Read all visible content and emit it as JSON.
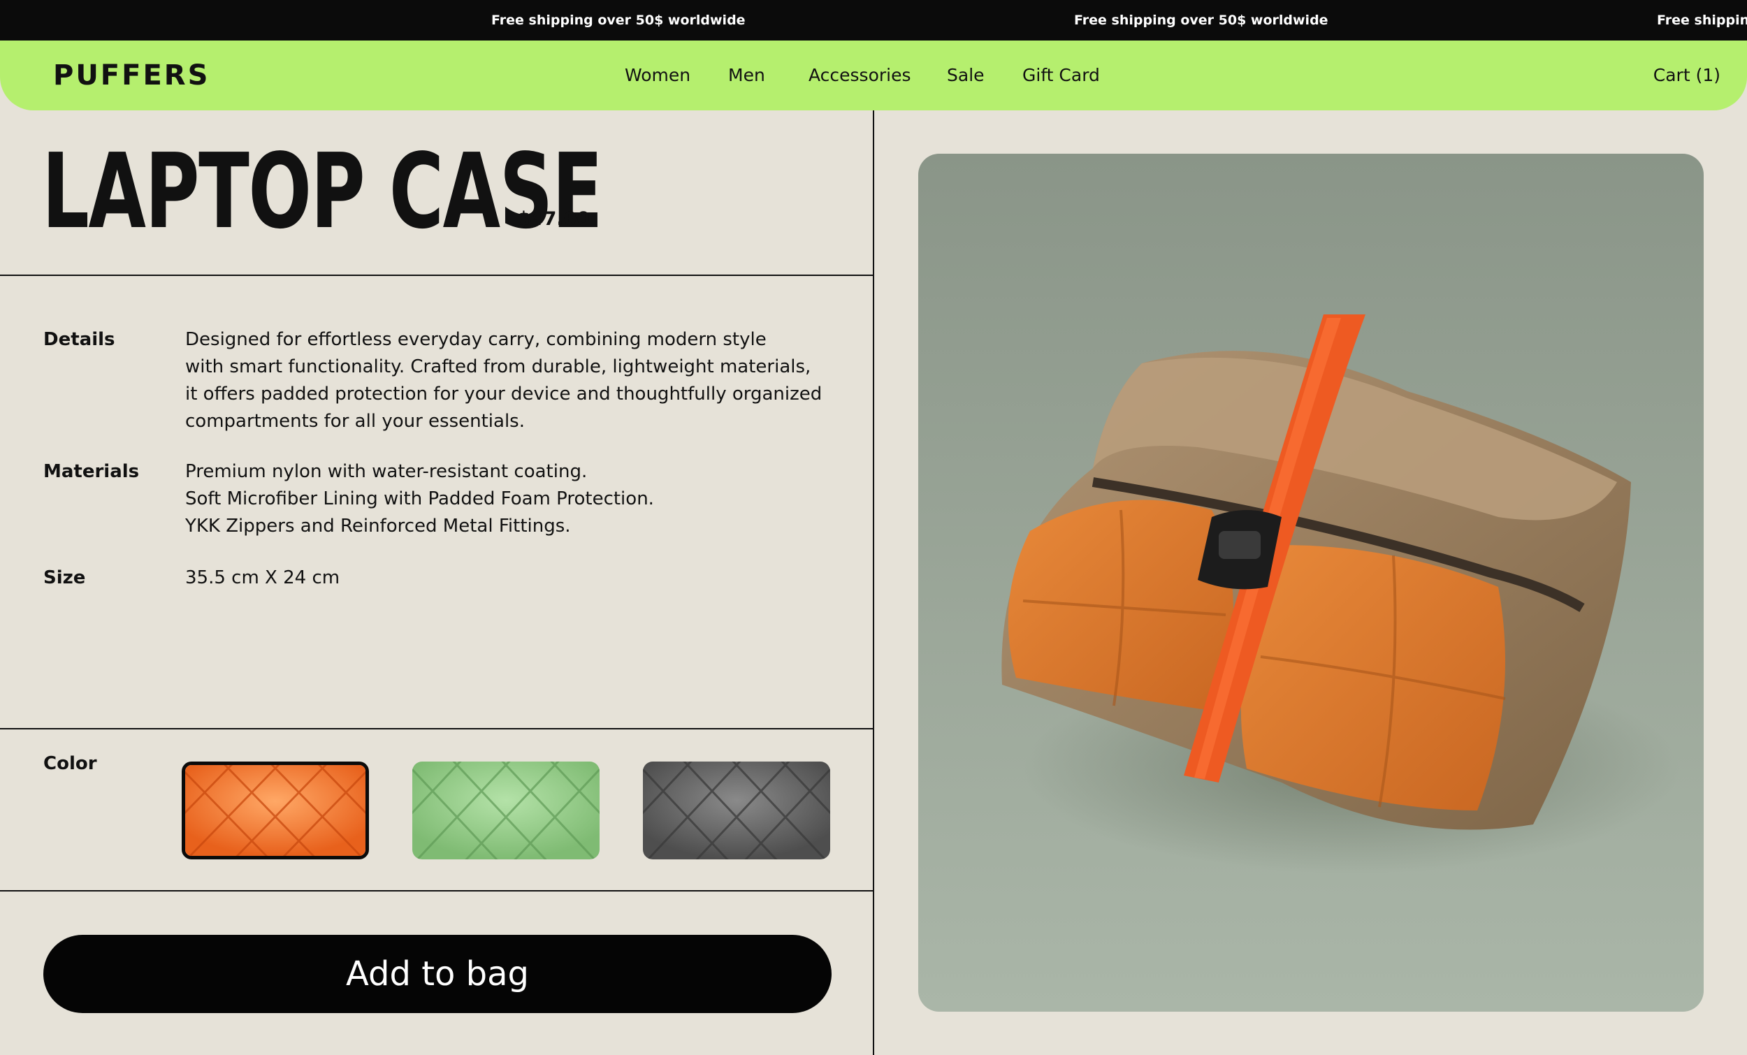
{
  "announcement": {
    "text": "Free shipping over 50$ worldwide"
  },
  "nav": {
    "logo": "PUFFERS",
    "links": [
      "Women",
      "Men",
      "Accessories",
      "Sale",
      "Gift Card"
    ],
    "cart_label": "Cart (1)"
  },
  "product": {
    "title": "LAPTOP CASE",
    "price": "$47.00",
    "details_label": "Details",
    "details_lines": [
      "Designed for effortless everyday carry, combining modern style",
      "with smart functionality. Crafted from durable, lightweight materials,",
      "it offers padded protection for your device and thoughtfully organized",
      "compartments for all your essentials."
    ],
    "materials_label": "Materials",
    "materials_lines": [
      "Premium nylon with water-resistant coating.",
      "Soft Microfiber Lining with Padded Foam Protection.",
      "YKK Zippers and Reinforced Metal Fittings."
    ],
    "size_label": "Size",
    "size_value": "35.5 cm X 24 cm",
    "color_label": "Color",
    "colors": [
      {
        "name": "orange",
        "hex": "#f07a2c",
        "selected": true
      },
      {
        "name": "green",
        "hex": "#8ec785",
        "selected": false
      },
      {
        "name": "gray",
        "hex": "#5e5e5e",
        "selected": false
      }
    ],
    "add_to_bag_label": "Add to bag"
  },
  "colors": {
    "announcement_bg": "#0b0b0b",
    "nav_bg": "#b5ef6e",
    "page_bg": "#e6e2d8",
    "photo_bg": "#9aa79a",
    "button_bg": "#050505"
  }
}
